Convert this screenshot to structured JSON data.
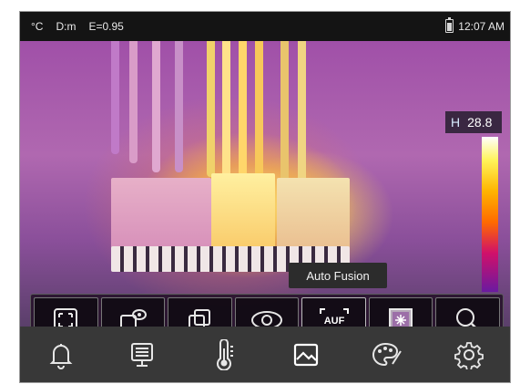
{
  "status": {
    "unit": "°C",
    "distance": "D:m",
    "emissivity": "E=0.95",
    "time": "12:07 AM"
  },
  "scale": {
    "mode": "H",
    "high_value": "28.8"
  },
  "tooltip": {
    "text": "Auto Fusion"
  },
  "toolbar": {
    "items": [
      {
        "name": "full-screen-mode",
        "icon": "frame-corners-icon"
      },
      {
        "name": "picture-in-picture-view",
        "icon": "pip-eye-icon"
      },
      {
        "name": "picture-in-picture",
        "icon": "overlap-squares-icon"
      },
      {
        "name": "visible-image",
        "icon": "eye-icon"
      },
      {
        "name": "auto-fusion",
        "icon": "auf-icon",
        "label": "AUF"
      },
      {
        "name": "thermal-image",
        "icon": "thermal-square-icon"
      },
      {
        "name": "zoom",
        "icon": "magnifier-icon"
      }
    ],
    "selected_index": 4
  },
  "bottom_nav": {
    "items": [
      {
        "name": "alarm",
        "icon": "bell-icon"
      },
      {
        "name": "display",
        "icon": "monitor-icon"
      },
      {
        "name": "measurement",
        "icon": "thermometer-icon"
      },
      {
        "name": "image",
        "icon": "picture-icon"
      },
      {
        "name": "palette",
        "icon": "palette-icon"
      },
      {
        "name": "settings",
        "icon": "gear-icon"
      }
    ]
  },
  "colors": {
    "accent": "#ffffff",
    "background": "#383838",
    "statusbar": "#141414"
  }
}
